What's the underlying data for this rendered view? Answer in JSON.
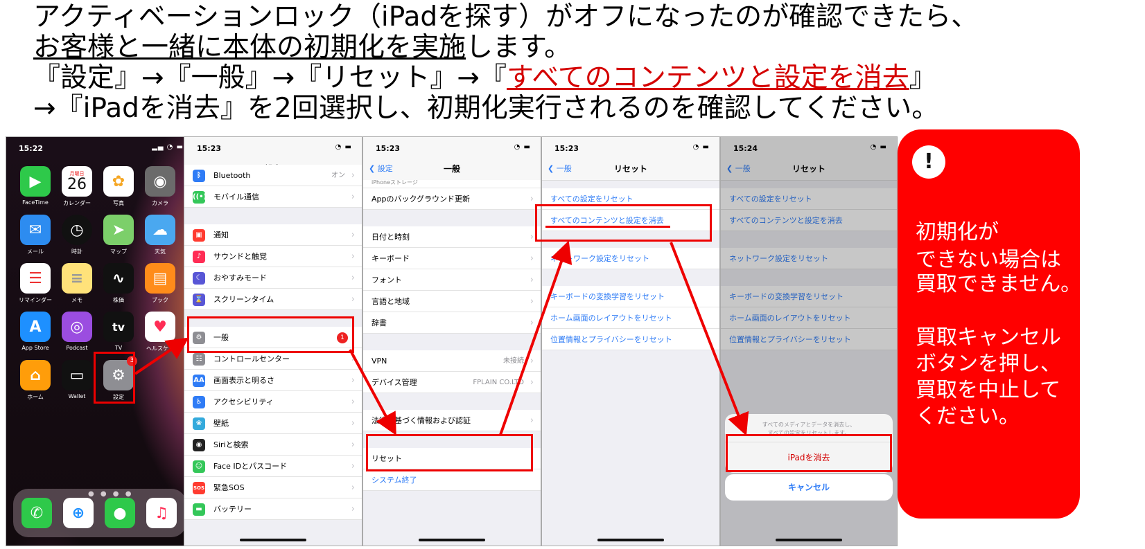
{
  "instructions": {
    "line1": "アクティベーションロック（iPadを探す）がオフになったのが確認できたら、",
    "line2_underlined": "お客様と一緒に本体の初期化を実施",
    "line2_rest": "します。",
    "line3_pre": "『設定』→『一般』→『リセット』→『",
    "line3_red": "すべてのコンテンツと設定を消去",
    "line3_post": "』",
    "line4": "→『iPadを消去』を2回選択し、初期化実行されるのを確認してください。"
  },
  "home_screen": {
    "time": "15:22",
    "date_weekday": "月曜日",
    "date_day": "26",
    "settings_badge": "3",
    "apps": [
      {
        "label": "FaceTime",
        "icon": "facetime-icon",
        "color": "#2ec94a"
      },
      {
        "label": "カレンダー",
        "icon": "calendar-icon",
        "color": "#ffffff"
      },
      {
        "label": "写真",
        "icon": "photos-icon",
        "color": "#ffffff"
      },
      {
        "label": "カメラ",
        "icon": "camera-icon",
        "color": "#6b6b6b"
      },
      {
        "label": "メール",
        "icon": "mail-icon",
        "color": "#2d8cf0"
      },
      {
        "label": "時計",
        "icon": "clock-icon",
        "color": "#111111"
      },
      {
        "label": "マップ",
        "icon": "maps-icon",
        "color": "#7ccf6a"
      },
      {
        "label": "天気",
        "icon": "weather-icon",
        "color": "#4aa8f0"
      },
      {
        "label": "リマインダー",
        "icon": "reminders-icon",
        "color": "#ffffff"
      },
      {
        "label": "メモ",
        "icon": "notes-icon",
        "color": "#ffe27a"
      },
      {
        "label": "株価",
        "icon": "stocks-icon",
        "color": "#111111"
      },
      {
        "label": "ブック",
        "icon": "books-icon",
        "color": "#ff8c1a"
      },
      {
        "label": "App Store",
        "icon": "app-store-icon",
        "color": "#1e90ff"
      },
      {
        "label": "Podcast",
        "icon": "podcast-icon",
        "color": "#9b4de0"
      },
      {
        "label": "TV",
        "icon": "tv-icon",
        "color": "#111111"
      },
      {
        "label": "ヘルスケア",
        "icon": "health-icon",
        "color": "#ffffff"
      },
      {
        "label": "ホーム",
        "icon": "home-app-icon",
        "color": "#ff9d0a"
      },
      {
        "label": "Wallet",
        "icon": "wallet-icon",
        "color": "#111111"
      },
      {
        "label": "設定",
        "icon": "settings-app-icon",
        "color": "#8e8e93"
      }
    ],
    "tv_glyph": "tv",
    "dock": [
      "phone-icon",
      "safari-icon",
      "messages-icon",
      "music-icon"
    ]
  },
  "settings_screen": {
    "time": "15:23",
    "title": "設定",
    "bluetooth_value": "オン",
    "rows": [
      "Bluetooth",
      "モバイル通信",
      "通知",
      "サウンドと触覚",
      "おやすみモード",
      "スクリーンタイム",
      "一般",
      "コントロールセンター",
      "画面表示と明るさ",
      "アクセシビリティ",
      "壁紙",
      "Siriと検索",
      "Face IDとパスコード",
      "緊急SOS",
      "バッテリー"
    ],
    "general_badge": "1",
    "aa_glyph": "AA",
    "sos_glyph": "SOS"
  },
  "general_screen": {
    "time": "15:23",
    "back": "設定",
    "title": "一般",
    "top_cut": "iPhoneストレージ",
    "rows": [
      "Appのバックグラウンド更新",
      "日付と時刻",
      "キーボード",
      "フォント",
      "言語と地域",
      "辞書",
      "VPN",
      "デバイス管理",
      "法律に基づく情報および認証",
      "リセット",
      "システム終了"
    ],
    "vpn_value": "未接続",
    "device_value": "FPLAIN CO.LTD"
  },
  "reset_screen": {
    "time": "15:23",
    "back": "一般",
    "title": "リセット",
    "rows": [
      "すべての設定をリセット",
      "すべてのコンテンツと設定を消去",
      "ネットワーク設定をリセット",
      "キーボードの変換学習をリセット",
      "ホーム画面のレイアウトをリセット",
      "位置情報とプライバシーをリセット"
    ]
  },
  "confirm_screen": {
    "time": "15:24",
    "back": "一般",
    "title": "リセット",
    "rows": [
      "すべての設定をリセット",
      "すべてのコンテンツと設定を消去",
      "ネットワーク設定をリセット",
      "キーボードの変換学習をリセット",
      "ホーム画面のレイアウトをリセット",
      "位置情報とプライバシーをリセット"
    ],
    "sheet_message_1": "すべてのメディアとデータを消去し、",
    "sheet_message_2": "すべての設定をリセットします。",
    "erase_button": "iPadを消去",
    "cancel_button": "キャンセル"
  },
  "warning": {
    "symbol": "!",
    "text1": "初期化が",
    "text2": "できない場合は",
    "text3": "買取できません。",
    "text4": "買取キャンセル",
    "text5": "ボタンを押し、",
    "text6": "買取を中止して",
    "text7": "ください。"
  },
  "colors": {
    "accent_red": "#ff0000",
    "ios_blue": "#2f7cf6",
    "highlight": "#e00000"
  }
}
